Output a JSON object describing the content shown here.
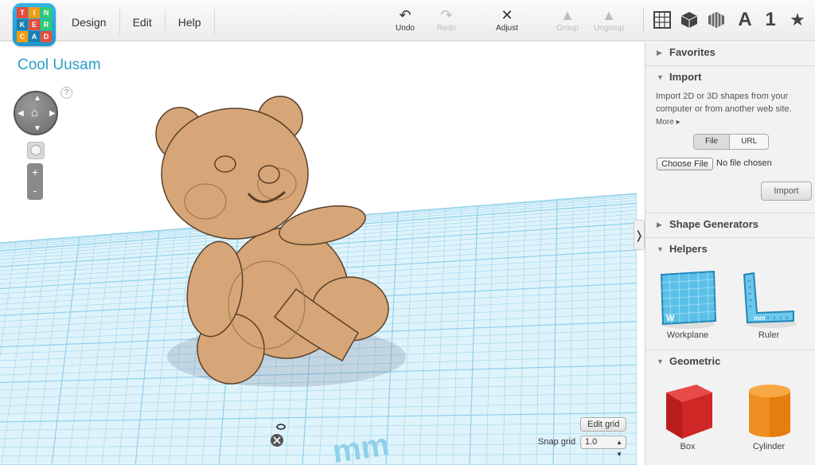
{
  "app": {
    "logo_letters": [
      "T",
      "I",
      "N",
      "K",
      "E",
      "R",
      "C",
      "A",
      "D"
    ],
    "menu": [
      "Design",
      "Edit",
      "Help"
    ]
  },
  "toolbar": {
    "undo": "Undo",
    "redo": "Redo",
    "adjust": "Adjust",
    "group": "Group",
    "ungroup": "Ungroup"
  },
  "view_toolbar": {
    "text_label": "A",
    "number_label": "1"
  },
  "canvas": {
    "project_title": "Cool Uusam",
    "help": "?",
    "zoom_in": "+",
    "zoom_out": "-",
    "grid_unit": "mm",
    "edit_grid": "Edit grid",
    "snap_grid_label": "Snap grid",
    "snap_grid_value": "1.0"
  },
  "sidebar": {
    "favorites": "Favorites",
    "import": {
      "title": "Import",
      "description": "Import 2D or 3D shapes from your computer or from another web site.",
      "more": "More",
      "tabs": [
        "File",
        "URL"
      ],
      "choose_file": "Choose File",
      "no_file": "No file chosen",
      "button": "Import"
    },
    "shape_generators": "Shape Generators",
    "helpers": {
      "title": "Helpers",
      "items": [
        "Workplane",
        "Ruler"
      ],
      "workplane_mark": "W",
      "ruler_mark": "mm"
    },
    "geometric": {
      "title": "Geometric",
      "items": [
        "Box",
        "Cylinder"
      ]
    }
  },
  "colors": {
    "grid_line": "#8fd0ea",
    "grid_background": "#dff3fb",
    "title_color": "#2a9fc9",
    "bear_fill": "#d6a678",
    "box_red": "#d42a2a",
    "cylinder_orange": "#f08a18"
  }
}
